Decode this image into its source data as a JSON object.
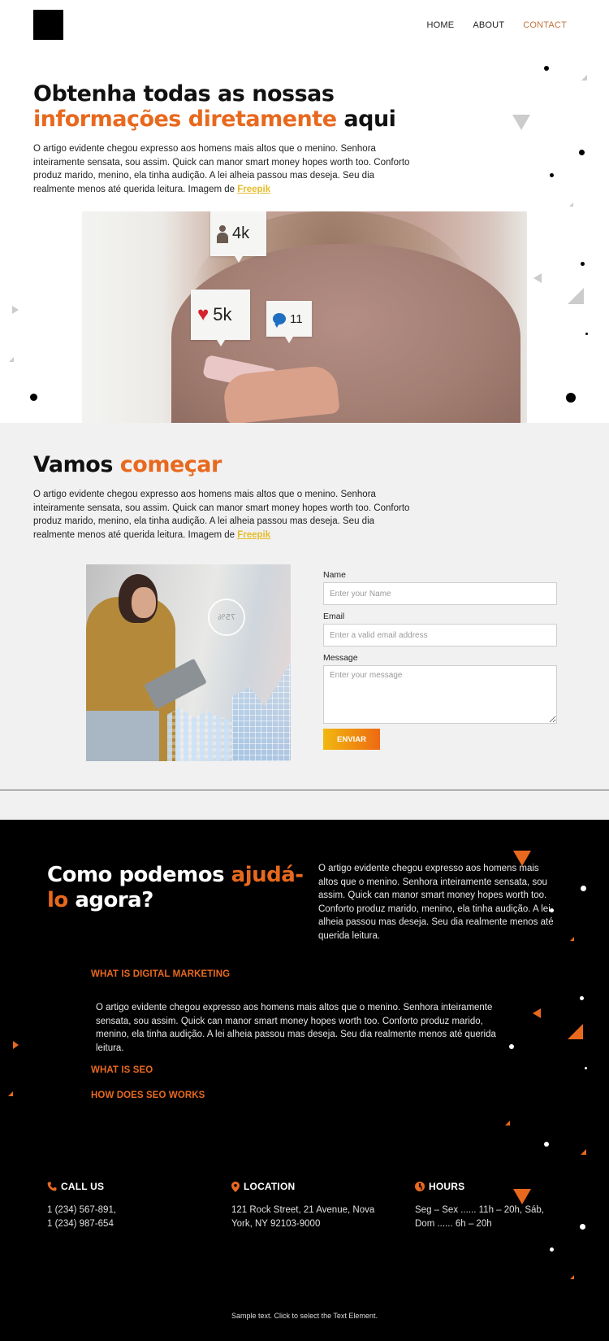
{
  "header": {
    "nav": [
      {
        "label": "HOME",
        "active": false
      },
      {
        "label": "ABOUT",
        "active": false
      },
      {
        "label": "CONTACT",
        "active": true
      }
    ]
  },
  "hero": {
    "title_part1": "Obtenha todas as nossas ",
    "title_highlight1": "informações diretamente",
    "title_part2": " aqui",
    "text": "O artigo evidente chegou expresso aos homens mais altos que o menino. Senhora inteiramente sensata, sou assim. Quick can manor smart money hopes worth too. Conforto produz marido, menino, ela tinha audição. A lei alheia passou mas deseja. Seu dia realmente menos até querida leitura. Imagem de ",
    "link": "Freepik",
    "bubbles": {
      "followers": "4k",
      "likes": "5k",
      "comments": "11"
    }
  },
  "start": {
    "title_part1": "Vamos ",
    "title_highlight": "começar",
    "text": "O artigo evidente chegou expresso aos homens mais altos que o menino. Senhora inteiramente sensata, sou assim. Quick can manor smart money hopes worth too. Conforto produz marido, menino, ela tinha audição. A lei alheia passou mas deseja. Seu dia realmente menos até querida leitura. Imagem de ",
    "link": "Freepik",
    "image_overlay": "75%",
    "form": {
      "name_label": "Name",
      "name_placeholder": "Enter your Name",
      "email_label": "Email",
      "email_placeholder": "Enter a valid email address",
      "message_label": "Message",
      "message_placeholder": "Enter your message",
      "submit_label": "ENVIAR"
    }
  },
  "help": {
    "title_part1": "Como podemos ",
    "title_highlight": "ajudá-lo",
    "title_part2": " agora?",
    "text": "O artigo evidente chegou expresso aos homens mais altos que o menino. Senhora inteiramente sensata, sou assim. Quick can manor smart money hopes worth too. Conforto produz marido, menino, ela tinha audição. A lei alheia passou mas deseja. Seu dia realmente menos até querida leitura.",
    "faq": [
      {
        "question": "WHAT IS DIGITAL MARKETING",
        "answer": "O artigo evidente chegou expresso aos homens mais altos que o menino. Senhora inteiramente sensata, sou assim. Quick can manor smart money hopes worth too. Conforto produz marido, menino, ela tinha audição. A lei alheia passou mas deseja. Seu dia realmente menos até querida leitura.",
        "expanded": true
      },
      {
        "question": "WHAT IS SEO",
        "expanded": false
      },
      {
        "question": "HOW DOES SEO WORKS",
        "expanded": false
      }
    ]
  },
  "contact_info": [
    {
      "icon": "phone-icon",
      "title": "CALL US",
      "lines": [
        "1 (234) 567-891,",
        "1 (234) 987-654"
      ]
    },
    {
      "icon": "location-pin-icon",
      "title": "LOCATION",
      "lines": [
        "121 Rock Street, 21 Avenue, Nova",
        "York, NY 92103-9000"
      ]
    },
    {
      "icon": "clock-icon",
      "title": "HOURS",
      "lines": [
        "Seg – Sex ...... 11h – 20h, Sáb,",
        "Dom  ...... 6h – 20h"
      ]
    }
  ],
  "footer": {
    "text": "Sample text. Click to select the Text Element."
  },
  "colors": {
    "accent": "#e8691e",
    "link": "#e4bc2a",
    "nav_active": "#c0763f",
    "dark_bg": "#000000",
    "light_bg": "#f1f1f1"
  }
}
